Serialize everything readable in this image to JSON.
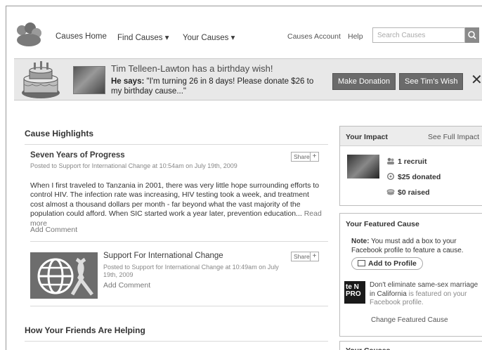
{
  "nav": {
    "causes_home": "Causes Home",
    "find_causes": "Find Causes",
    "your_causes": "Your Causes",
    "account": "Causes Account",
    "help": "Help",
    "search_placeholder": "Search Causes"
  },
  "banner": {
    "title": "Tim Telleen-Lawton has a birthday wish!",
    "says_label": "He says:",
    "says_text": "\"I'm turning 26 in 8 days! Please donate $26 to my birthday cause...\"",
    "donate_button": "Make Donation",
    "wish_button": "See Tim's Wish",
    "close": "✕"
  },
  "highlights": {
    "heading": "Cause Highlights",
    "post": {
      "title": "Seven Years of Progress",
      "meta_prefix": "Posted to",
      "meta_cause": "Support for International Change",
      "meta_time": "at 10:54am on July 19th, 2009",
      "share": "Share",
      "body": "When I first traveled to Tanzania in 2001, there was very little hope surrounding efforts to control HIV. The infection rate was increasing, HIV testing took a week, and treatment cost almost a thousand dollars per month - far beyond what the vast majority of the population could afford. When SIC started work a year later, prevention education...",
      "read_more": "Read more",
      "add_comment": "Add Comment"
    },
    "cause_post": {
      "title": "Support For International Change",
      "meta_prefix": "Posted to",
      "meta_cause": "Support for International Change",
      "meta_time": "at 10:49am on July 19th, 2009",
      "share": "Share",
      "add_comment": "Add Comment"
    }
  },
  "friends": {
    "heading": "How Your Friends Are Helping"
  },
  "impact": {
    "heading": "Your Impact",
    "link": "See Full Impact",
    "recruit": "1 recruit",
    "donated_amount": "$25",
    "donated_label": "donated",
    "raised_amount": "$0",
    "raised_label": "raised"
  },
  "featured": {
    "heading": "Your Featured Cause",
    "note_label": "Note:",
    "note_text": "You must add a box to your Facebook profile to feature a cause.",
    "add_profile": "Add to Profile",
    "logo_text": "te N PRO",
    "cause_name": "Don't eliminate same-sex marriage in California",
    "cause_suffix": "is featured on your Facebook profile.",
    "change": "Change Featured Cause"
  },
  "your_causes": {
    "heading": "Your Causes"
  }
}
